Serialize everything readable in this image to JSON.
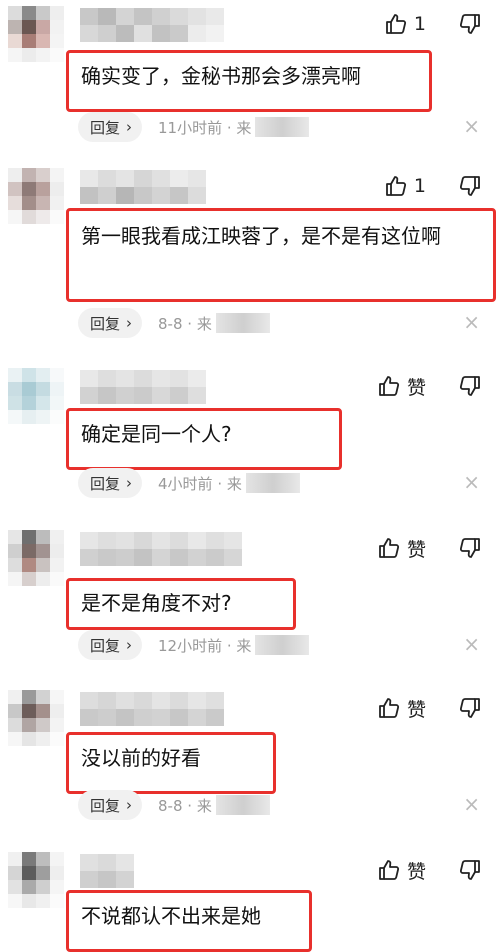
{
  "colors": {
    "highlight_border": "#e8302c",
    "reply_bg": "#f1f1f1"
  },
  "comments": [
    {
      "text": "确实变了，金秘书那会多漂亮啊",
      "likes": "1",
      "reply": "回复",
      "time": "11小时前 · 来"
    },
    {
      "text": "第一眼我看成江映蓉了，是不是有这位啊",
      "likes": "1",
      "reply": "回复",
      "time": "8-8 · 来"
    },
    {
      "text": "确定是同一个人?",
      "likes": "赞",
      "reply": "回复",
      "time": "4小时前 · 来"
    },
    {
      "text": "是不是角度不对?",
      "likes": "赞",
      "reply": "回复",
      "time": "12小时前 · 来"
    },
    {
      "text": "没以前的好看",
      "likes": "赞",
      "reply": "回复",
      "time": "8-8 · 来"
    },
    {
      "text": "不说都认不出来是她",
      "likes": "赞"
    }
  ],
  "icons": {
    "like": "thumbs-up-icon",
    "dislike": "thumbs-down-icon",
    "reply_arrow": "chevron-right-icon",
    "close": "close-icon"
  },
  "close_glyph": "×"
}
